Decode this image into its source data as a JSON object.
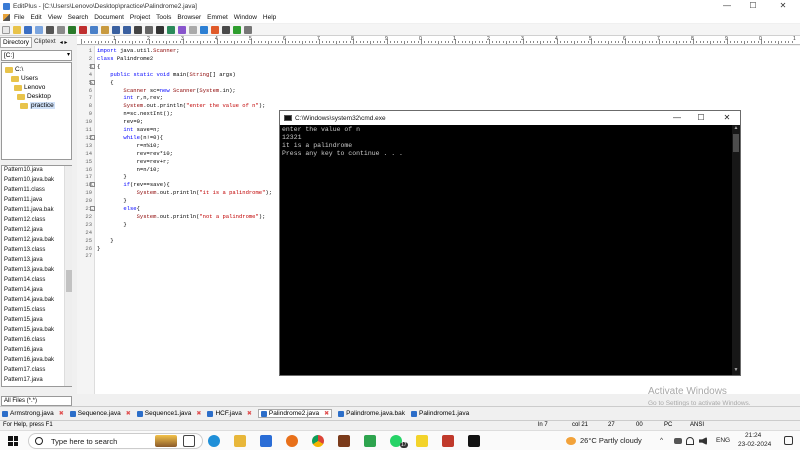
{
  "window": {
    "title": "EditPlus - [C:\\Users\\Lenovo\\Desktop\\practice\\Palindrome2.java]",
    "min": "—",
    "max": "☐",
    "close": "✕"
  },
  "menu": [
    "File",
    "Edit",
    "View",
    "Search",
    "Document",
    "Project",
    "Tools",
    "Browser",
    "Emmet",
    "Window",
    "Help"
  ],
  "left_panel": {
    "tabs": [
      "Directory",
      "Cliptext"
    ],
    "arrows": "◂ ▸",
    "drive": "[C:]",
    "tree": [
      "C:\\",
      "Users",
      "Lenovo",
      "Desktop",
      "practice"
    ],
    "files": [
      "Pattern10.java",
      "Pattern10.java.bak",
      "Pattern11.class",
      "Pattern11.java",
      "Pattern11.java.bak",
      "Pattern12.class",
      "Pattern12.java",
      "Pattern12.java.bak",
      "Pattern13.class",
      "Pattern13.java",
      "Pattern13.java.bak",
      "Pattern14.class",
      "Pattern14.java",
      "Pattern14.java.bak",
      "Pattern15.class",
      "Pattern15.java",
      "Pattern15.java.bak",
      "Pattern16.class",
      "Pattern16.java",
      "Pattern16.java.bak",
      "Pattern17.class",
      "Pattern17.java"
    ],
    "filter": "All Files (*.*)"
  },
  "ruler": {
    "numbers": [
      "1",
      "2",
      "3",
      "4",
      "5",
      "6",
      "7",
      "8",
      "9",
      "0",
      "1",
      "2",
      "3",
      "4",
      "5",
      "6",
      "7",
      "8",
      "9",
      "0",
      "1"
    ]
  },
  "editor": {
    "line_numbers": [
      "1",
      "2",
      "3",
      "4",
      "5",
      "6",
      "7",
      "8",
      "9",
      "10",
      "11",
      "12",
      "13",
      "14",
      "15",
      "16",
      "17",
      "18",
      "19",
      "20",
      "21",
      "22",
      "23",
      "24",
      "25",
      "26",
      "27"
    ],
    "lines": [
      "import java.util.Scanner;",
      "class Palindrome2",
      "{",
      "    public static void main(String[] args)",
      "    {",
      "        Scanner sc=new Scanner(System.in);",
      "        int r,n,rev;",
      "        System.out.println(\"enter the value of n\");",
      "        n=sc.nextInt();",
      "        rev=0;",
      "        int save=n;",
      "        while(n!=0){",
      "            r=n%10;",
      "            rev=rev*10;",
      "            rev=rev+r;",
      "            n=n/10;",
      "        }",
      "        if(rev==save){",
      "            System.out.println(\"it is a palindrome\");",
      "        }",
      "        else{",
      "            System.out.println(\"not a palindrome\");",
      "        }",
      "",
      "    }",
      "}",
      ""
    ]
  },
  "cmd": {
    "title": "C:\\Windows\\system32\\cmd.exe",
    "min": "—",
    "max": "☐",
    "close": "✕",
    "output": [
      "enter the value of n",
      "12321",
      "it is a palindrome",
      "Press any key to continue . . ."
    ]
  },
  "watermark": {
    "line1": "Activate Windows",
    "line2": "Go to Settings to activate Windows."
  },
  "doc_tabs": [
    "Armstrong.java",
    "Sequence.java",
    "Sequence1.java",
    "HCF.java",
    "Palindrome2.java",
    "Palindrome.java.bak",
    "Palindrome1.java"
  ],
  "active_tab": "Palindrome2.java",
  "status": {
    "help": "For Help, press F1",
    "ln": "ln 7",
    "col": "col 21",
    "num": "27",
    "zero": "00",
    "pc": "PC",
    "enc": "ANSI"
  },
  "taskbar": {
    "search_placeholder": "Type here to search",
    "weather": "26°C  Partly cloudy",
    "lang": "ENG",
    "time": "21:24",
    "date": "23-02-2024",
    "tray_arrow": "^",
    "badge": "17"
  },
  "colors": {
    "keyword": "#0000ff",
    "type": "#8b0000",
    "string": "#c00000",
    "console_bg": "#000000",
    "console_text": "#cccccc"
  }
}
